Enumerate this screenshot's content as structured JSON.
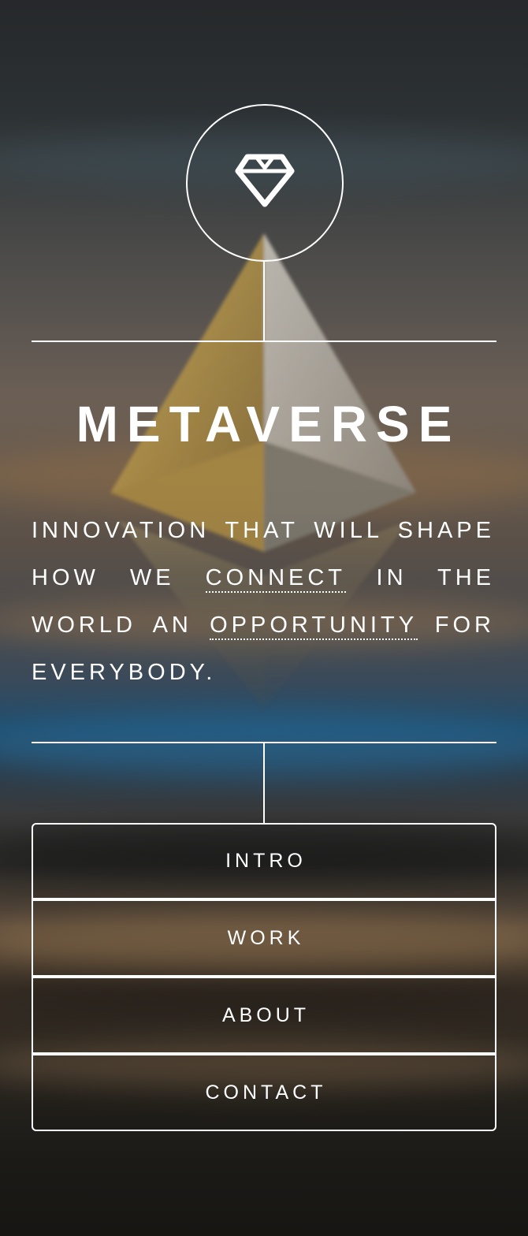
{
  "logo": {
    "icon": "diamond-icon"
  },
  "hero": {
    "title": "METAVERSE",
    "tagline_part1": "INNOVATION THAT WILL SHAPE HOW WE ",
    "tagline_link1": "CONNECT",
    "tagline_part2": " IN THE WORLD AN ",
    "tagline_link2": "OPPORTUNITY",
    "tagline_part3": " FOR EVERYBODY."
  },
  "nav": {
    "items": [
      {
        "label": "INTRO"
      },
      {
        "label": "WORK"
      },
      {
        "label": "ABOUT"
      },
      {
        "label": "CONTACT"
      }
    ]
  },
  "colors": {
    "foreground": "#ffffff",
    "eth_gold": "#c9a64a",
    "eth_silver": "#b9b4aa",
    "sea_blue": "#1f4d6d"
  }
}
